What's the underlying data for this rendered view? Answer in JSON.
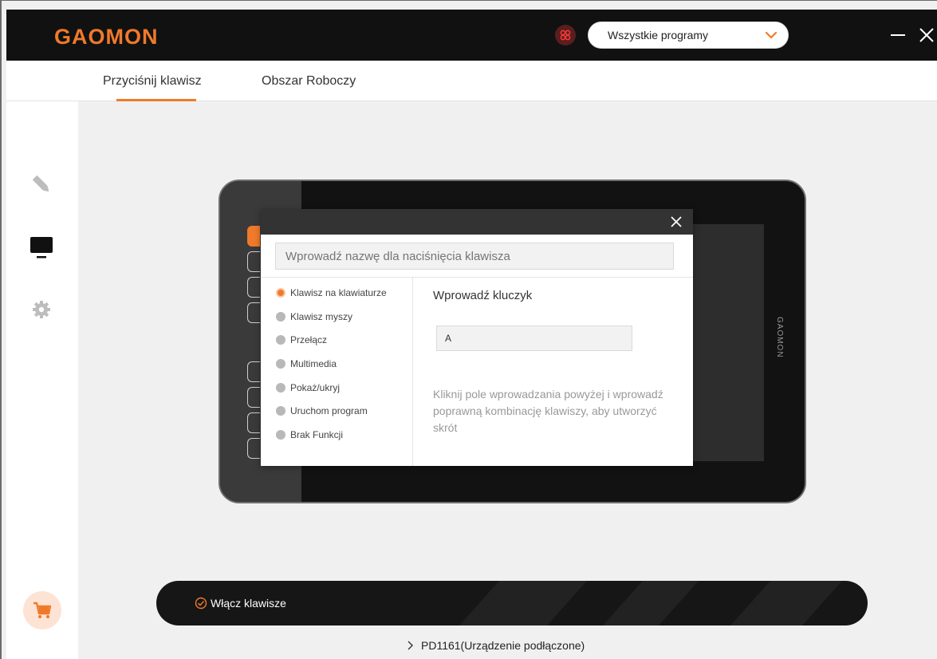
{
  "header": {
    "logo_text": "GAOMON",
    "program_select": "Wszystkie programy"
  },
  "tabs": [
    {
      "label": "Przyciśnij klawisz"
    },
    {
      "label": "Obszar Roboczy"
    }
  ],
  "sidebar": {
    "icons": [
      "pen-icon",
      "monitor-icon",
      "gear-icon",
      "cart-icon"
    ]
  },
  "tablet": {
    "brand": "GAOMON"
  },
  "dialog": {
    "name_placeholder": "Wprowadź nazwę dla naciśnięcia klawisza",
    "options": [
      "Klawisz na klawiaturze",
      "Klawisz myszy",
      "Przełącz",
      "Multimedia",
      "Pokaż/ukryj",
      "Uruchom program",
      "Brak Funkcji"
    ],
    "selected_option": "Klawisz na klawiaturze",
    "key_title": "Wprowadź kluczyk",
    "key_value": "A",
    "hint": "Kliknij pole wprowadzania powyżej i wprowadź poprawną kombinację klawiszy, aby utworzyć skrót"
  },
  "enable_keys": {
    "label": "Włącz klawisze",
    "checked": true
  },
  "status": {
    "device": "PD1161(Urządzenie podłączone)"
  },
  "colors": {
    "accent": "#f07a2a",
    "topbar": "#111111"
  }
}
